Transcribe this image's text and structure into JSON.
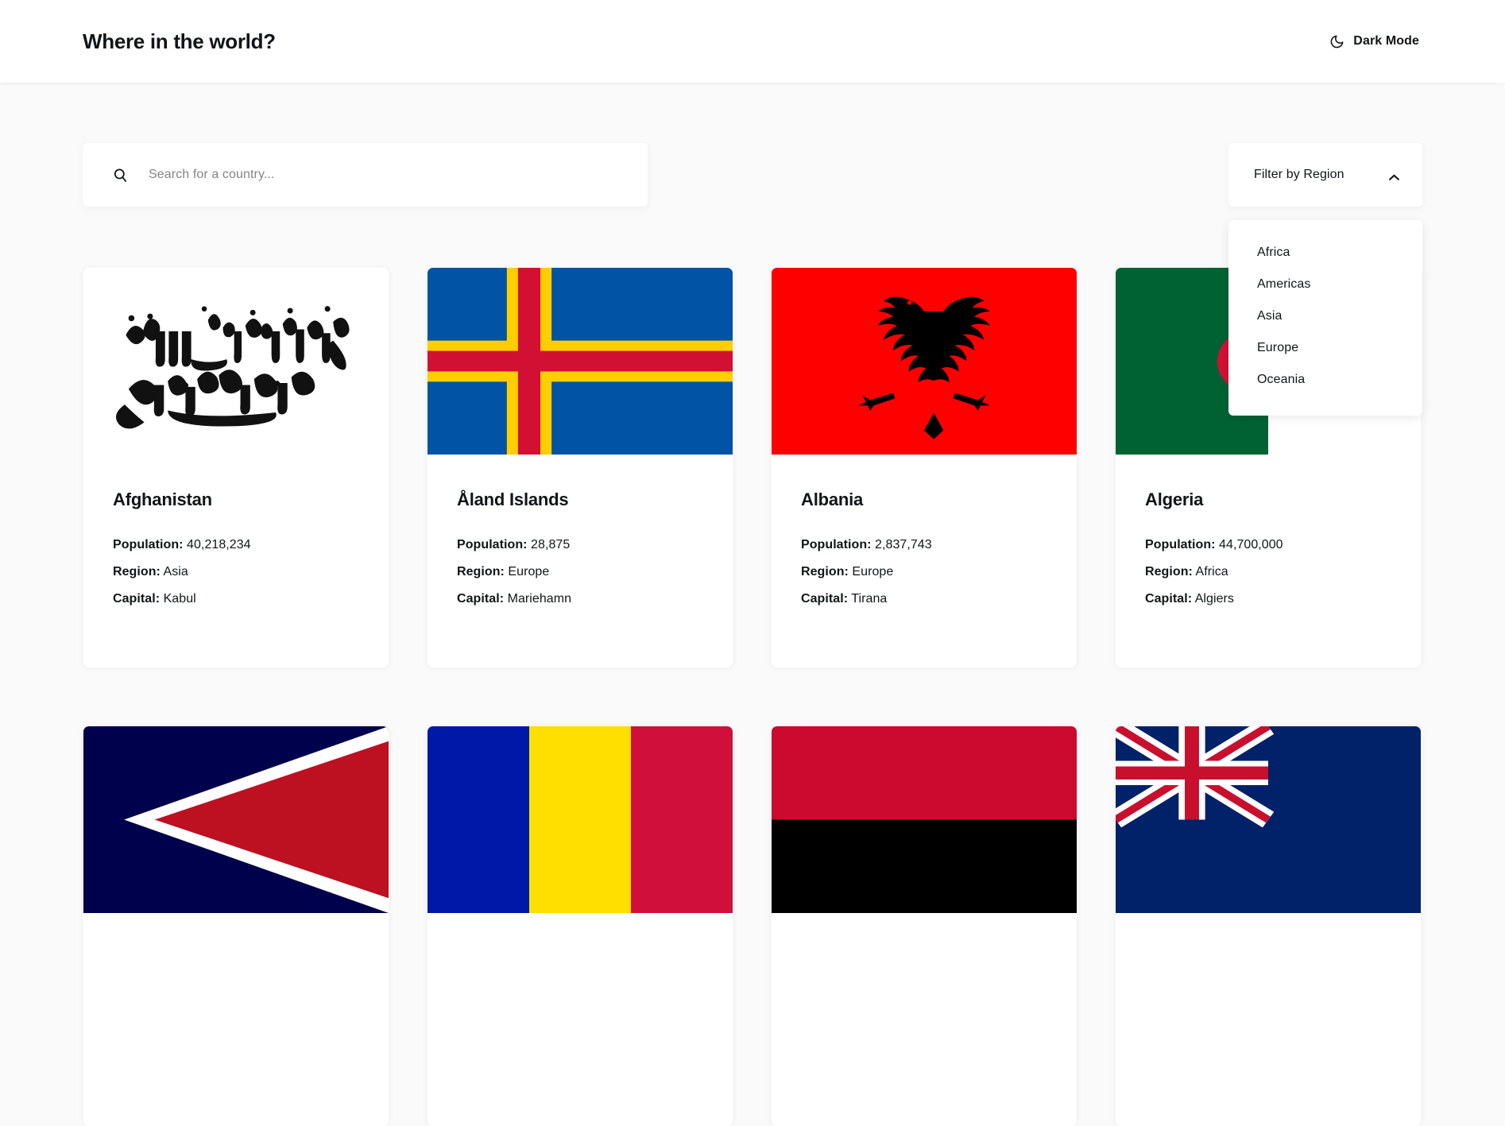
{
  "header": {
    "title": "Where in the world?",
    "theme_toggle_label": "Dark Mode",
    "theme_icon": "moon-icon"
  },
  "search": {
    "placeholder": "Search for a country...",
    "value": "",
    "icon": "search-icon"
  },
  "filter": {
    "label": "Filter by Region",
    "expanded": true,
    "chevron_icon": "chevron-up-icon",
    "options": [
      "Africa",
      "Americas",
      "Asia",
      "Europe",
      "Oceania"
    ]
  },
  "labels": {
    "population": "Population:",
    "region": "Region:",
    "capital": "Capital:"
  },
  "colors": {
    "page_background": "#fafafa",
    "surface": "#ffffff",
    "text": "#111517",
    "placeholder": "#848484"
  },
  "countries": [
    {
      "name": "Afghanistan",
      "population": "40,218,234",
      "region": "Asia",
      "capital": "Kabul",
      "flag": "afghanistan"
    },
    {
      "name": "Åland Islands",
      "population": "28,875",
      "region": "Europe",
      "capital": "Mariehamn",
      "flag": "aland-islands"
    },
    {
      "name": "Albania",
      "population": "2,837,743",
      "region": "Europe",
      "capital": "Tirana",
      "flag": "albania"
    },
    {
      "name": "Algeria",
      "population": "44,700,000",
      "region": "Africa",
      "capital": "Algiers",
      "flag": "algeria"
    }
  ],
  "next_row_flags": [
    "american-samoa",
    "andorra",
    "angola",
    "anguilla"
  ]
}
